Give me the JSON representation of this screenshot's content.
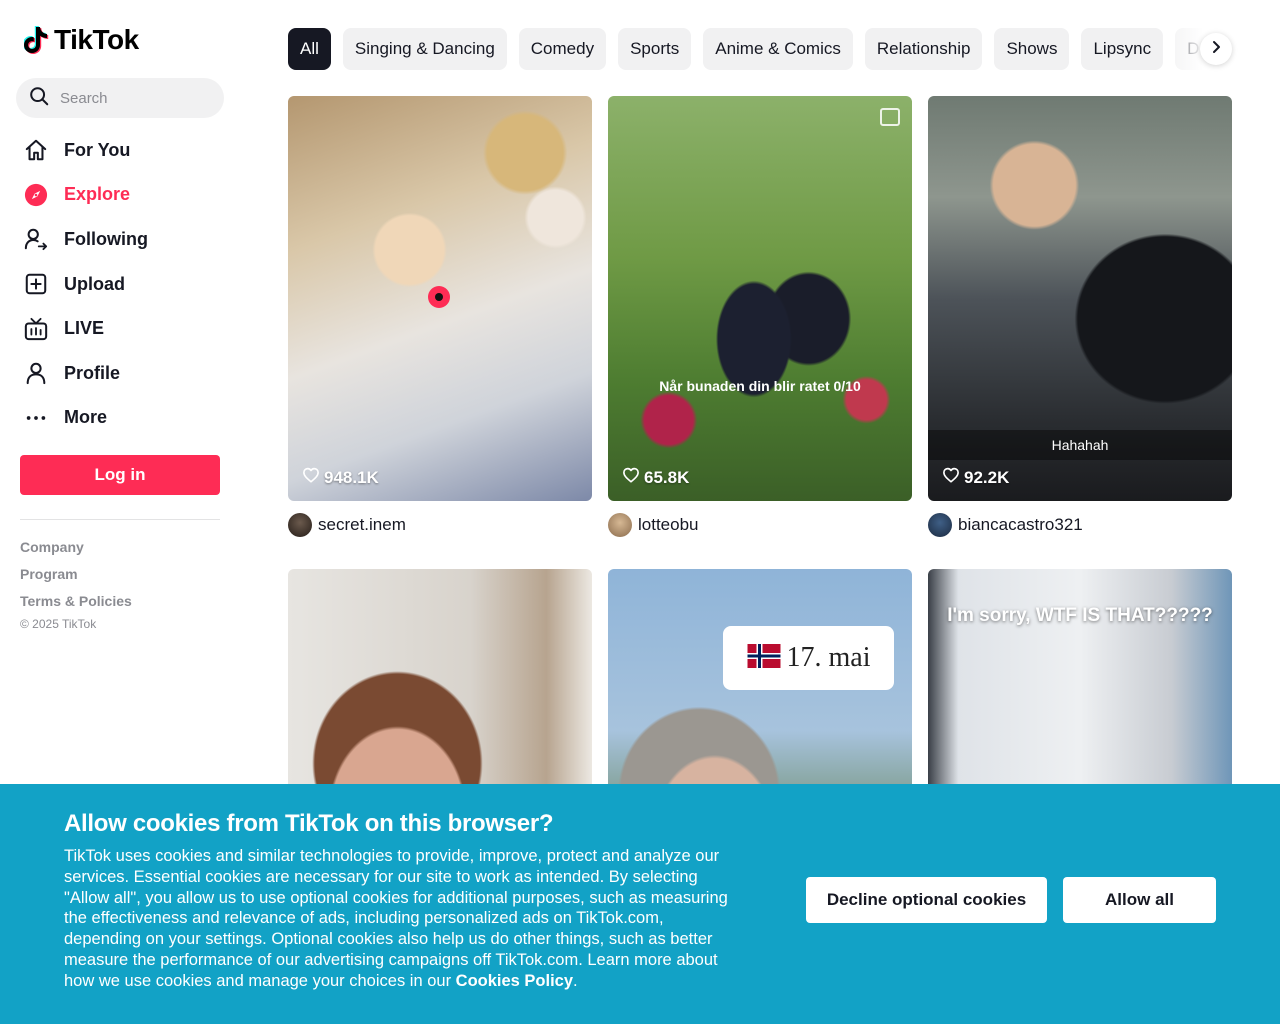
{
  "brand": {
    "name": "TikTok",
    "accent": "#fe2c55",
    "cyan": "#25f4ee"
  },
  "search": {
    "placeholder": "Search"
  },
  "nav": {
    "for_you": "For You",
    "explore": "Explore",
    "following": "Following",
    "upload": "Upload",
    "live": "LIVE",
    "profile": "Profile",
    "more": "More"
  },
  "login_label": "Log in",
  "footer": {
    "company": "Company",
    "program": "Program",
    "terms": "Terms & Policies",
    "copyright": "© 2025 TikTok"
  },
  "categories": [
    "All",
    "Singing & Dancing",
    "Comedy",
    "Sports",
    "Anime & Comics",
    "Relationship",
    "Shows",
    "Lipsync",
    "Da"
  ],
  "videos": [
    {
      "likes": "948.1K",
      "author": "secret.inem",
      "caption": ""
    },
    {
      "likes": "65.8K",
      "author": "lotteobu",
      "caption": "Når bunaden din blir ratet 0/10"
    },
    {
      "likes": "92.2K",
      "author": "biancacastro321",
      "caption": "Hahahah"
    },
    {
      "likes": "",
      "author": "",
      "caption": ""
    },
    {
      "likes": "",
      "author": "",
      "caption": "17. mai"
    },
    {
      "likes": "",
      "author": "",
      "caption": "I'm sorry, WTF IS THAT?????"
    }
  ],
  "cookie": {
    "title": "Allow cookies from TikTok on this browser?",
    "body": "TikTok uses cookies and similar technologies to provide, improve, protect and analyze our services. Essential cookies are necessary for our site to work as intended. By selecting \"Allow all\", you allow us to use optional cookies for additional purposes, such as measuring the effectiveness and relevance of ads, including personalized ads on TikTok.com, depending on your settings. Optional cookies also help us do other things, such as better measure the performance of our advertising campaigns off TikTok.com. Learn more about how we use cookies and manage your choices in our ",
    "policy_link": "Cookies Policy",
    "period": ".",
    "decline_label": "Decline optional cookies",
    "allow_label": "Allow all"
  }
}
